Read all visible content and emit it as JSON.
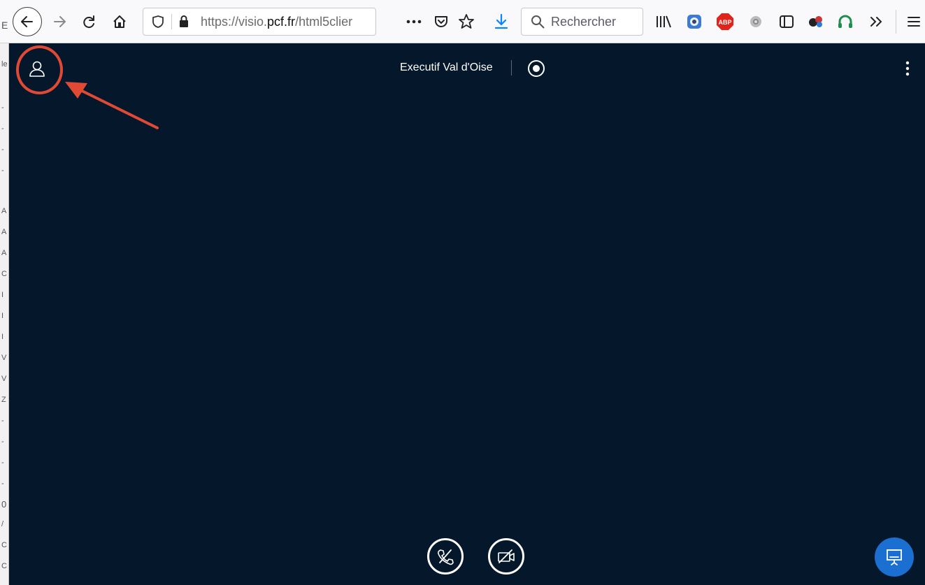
{
  "browser": {
    "url_prefix": "https://visio.",
    "url_host": "pcf.fr",
    "url_path": "/html5clier",
    "search_placeholder": "Rechercher",
    "left_strip_chars": [
      "E",
      "le",
      "-",
      "-",
      "-",
      "-",
      "A",
      "A",
      "A",
      "C",
      "I",
      "I",
      "I",
      "V",
      "V",
      "Z",
      "-",
      "-",
      "-",
      "-",
      "0",
      "/",
      "C",
      "C"
    ]
  },
  "meeting": {
    "title": "Executif Val d'Oise"
  },
  "icons": {
    "user_list": "user-icon",
    "record": "record-icon",
    "menu": "kebab-menu-icon",
    "leave_audio": "phone-off-icon",
    "video_off": "camera-off-icon",
    "presentation": "presentation-icon"
  },
  "colors": {
    "background": "#04172b",
    "accent": "#1a6fd1",
    "annotation": "#e04a35"
  }
}
